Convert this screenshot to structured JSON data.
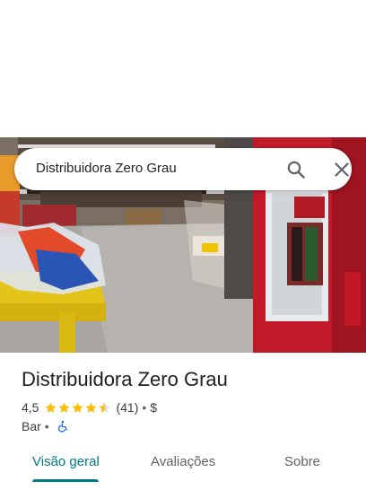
{
  "search": {
    "query": "Distribuidora Zero Grau"
  },
  "place": {
    "name": "Distribuidora Zero Grau",
    "rating": "4,5",
    "rating_value": 4.5,
    "review_count": "(41)",
    "price": "$",
    "category": "Bar",
    "separator": "•",
    "accessibility_icon": "wheelchair-icon"
  },
  "tabs": [
    {
      "label": "Visão geral",
      "active": true
    },
    {
      "label": "Avaliações",
      "active": false
    },
    {
      "label": "Sobre",
      "active": false
    }
  ],
  "colors": {
    "accent": "#007b83",
    "star": "#fbbc04",
    "accessibility": "#1a73e8"
  }
}
